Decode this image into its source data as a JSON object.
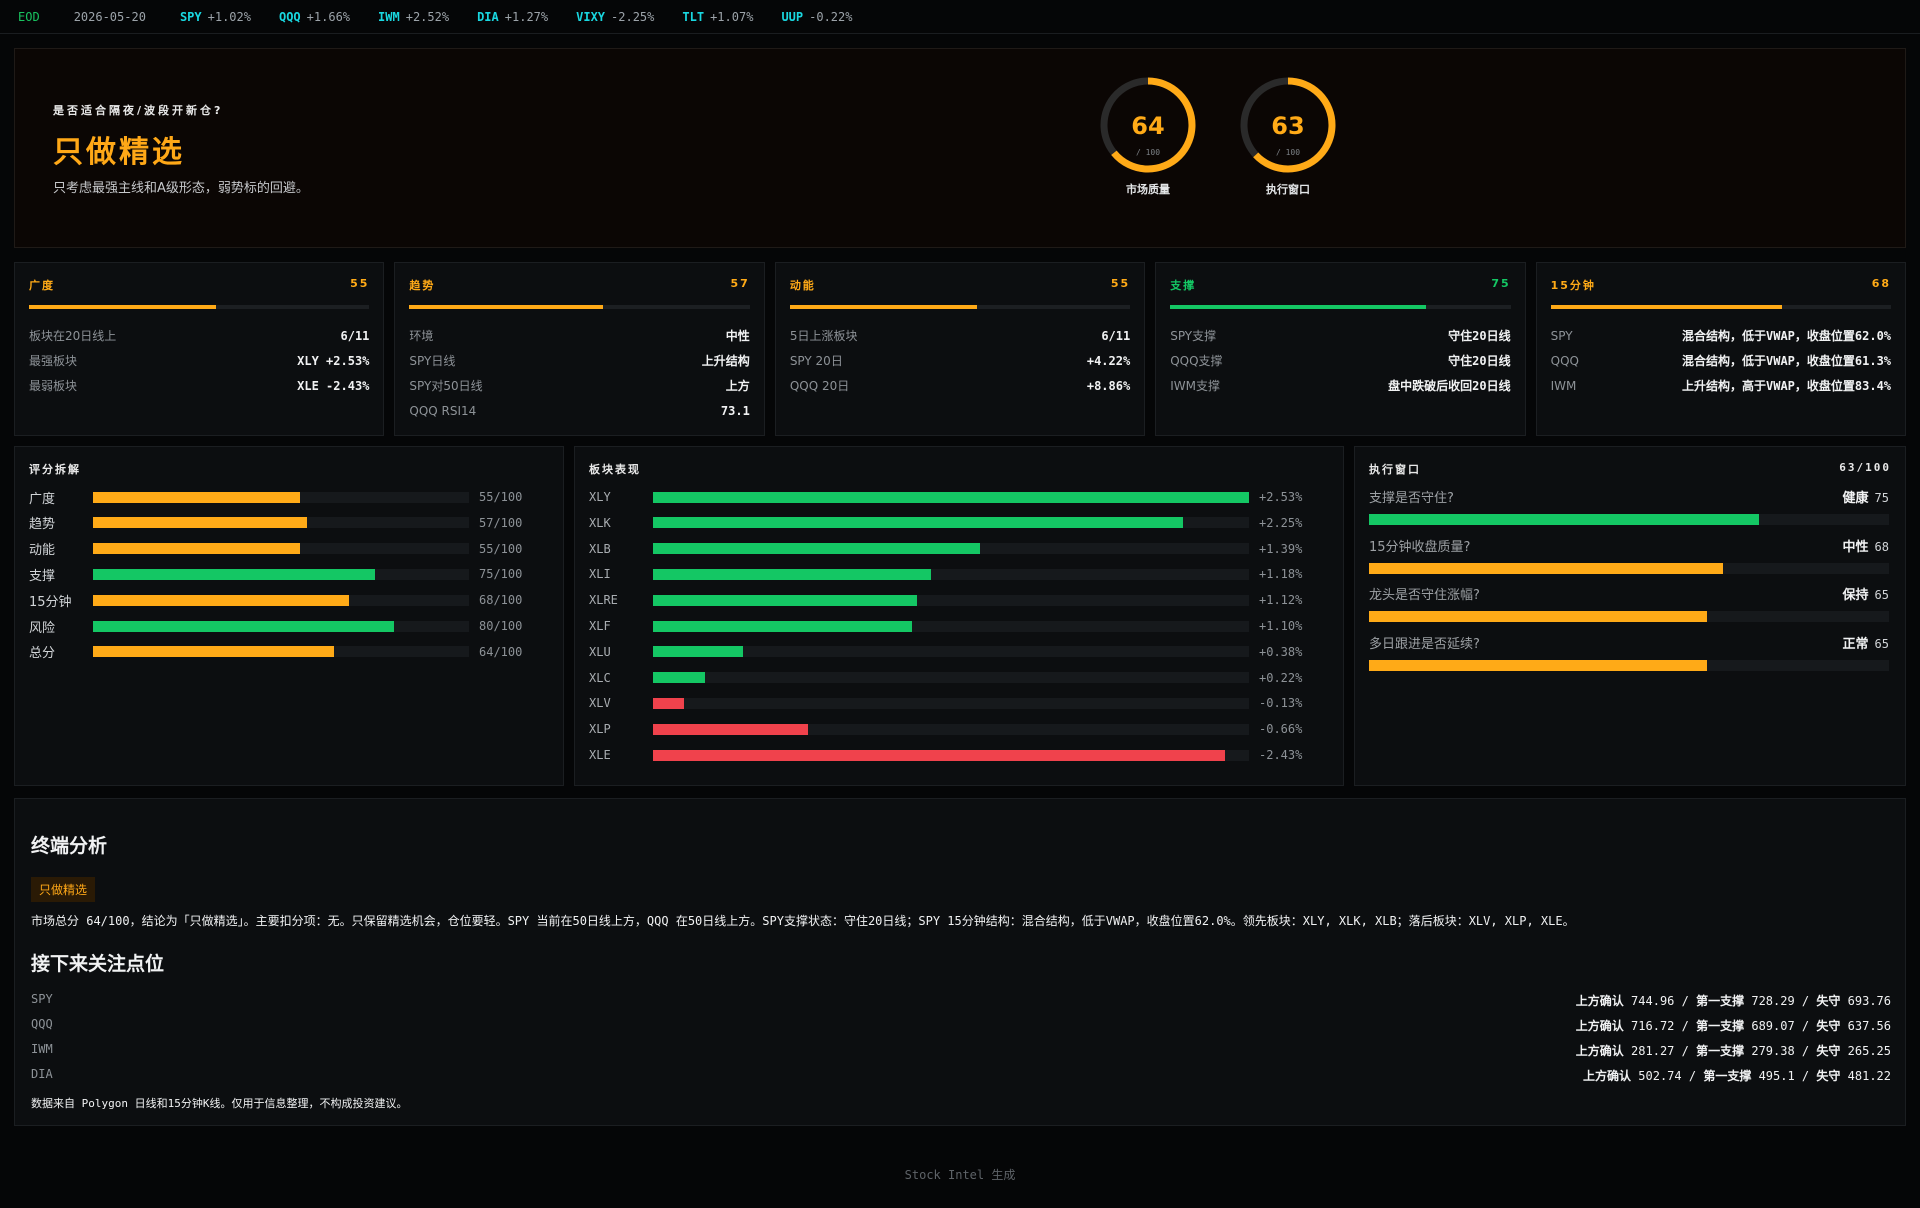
{
  "ticker": {
    "eod": "EOD",
    "date": "2026-05-20",
    "items": [
      {
        "sym": "SPY",
        "chg": "+1.02%"
      },
      {
        "sym": "QQQ",
        "chg": "+1.66%"
      },
      {
        "sym": "IWM",
        "chg": "+2.52%"
      },
      {
        "sym": "DIA",
        "chg": "+1.27%"
      },
      {
        "sym": "VIXY",
        "chg": "-2.25%"
      },
      {
        "sym": "TLT",
        "chg": "+1.07%"
      },
      {
        "sym": "UUP",
        "chg": "-0.22%"
      }
    ]
  },
  "hero": {
    "question": "是否适合隔夜/波段开新仓?",
    "verdict": "只做精选",
    "subtitle": "只考虑最强主线和A级形态，弱势标的回避。",
    "gauges": [
      {
        "value": 64,
        "value_text": "64",
        "denominator": "/ 100",
        "label": "市场质量"
      },
      {
        "value": 63,
        "value_text": "63",
        "denominator": "/ 100",
        "label": "执行窗口"
      }
    ]
  },
  "colors": {
    "orange": "#ffaa17",
    "green": "#14c764",
    "red": "#f0424c",
    "cyan": "#19d7e0"
  },
  "cards": [
    {
      "title": "广度",
      "score": "55",
      "level": 0.55,
      "color": "#ffaa17",
      "rows": [
        {
          "k": "板块在20日线上",
          "v": "6/11"
        },
        {
          "k": "最强板块",
          "v": "XLY +2.53%"
        },
        {
          "k": "最弱板块",
          "v": "XLE -2.43%"
        }
      ]
    },
    {
      "title": "趋势",
      "score": "57",
      "level": 0.57,
      "color": "#ffaa17",
      "rows": [
        {
          "k": "环境",
          "v": "中性"
        },
        {
          "k": "SPY日线",
          "v": "上升结构"
        },
        {
          "k": "SPY对50日线",
          "v": "上方"
        },
        {
          "k": "QQQ RSI14",
          "v": "73.1"
        }
      ]
    },
    {
      "title": "动能",
      "score": "55",
      "level": 0.55,
      "color": "#ffaa17",
      "rows": [
        {
          "k": "5日上涨板块",
          "v": "6/11"
        },
        {
          "k": "SPY 20日",
          "v": "+4.22%"
        },
        {
          "k": "QQQ 20日",
          "v": "+8.86%"
        }
      ]
    },
    {
      "title": "支撑",
      "score": "75",
      "level": 0.75,
      "color": "#14c764",
      "rows": [
        {
          "k": "SPY支撑",
          "v": "守住20日线"
        },
        {
          "k": "QQQ支撑",
          "v": "守住20日线"
        },
        {
          "k": "IWM支撑",
          "v": "盘中跌破后收回20日线"
        }
      ]
    },
    {
      "title": "15分钟",
      "score": "68",
      "level": 0.68,
      "color": "#ffaa17",
      "rows": [
        {
          "k": "SPY",
          "v": "混合结构，低于VWAP，收盘位置62.0%"
        },
        {
          "k": "QQQ",
          "v": "混合结构，低于VWAP，收盘位置61.3%"
        },
        {
          "k": "IWM",
          "v": "上升结构，高于VWAP，收盘位置83.4%"
        }
      ]
    }
  ],
  "scores": {
    "title": "评分拆解",
    "items": [
      {
        "label": "广度",
        "value": 55,
        "text": "55/100",
        "color": "#ffaa17"
      },
      {
        "label": "趋势",
        "value": 57,
        "text": "57/100",
        "color": "#ffaa17"
      },
      {
        "label": "动能",
        "value": 55,
        "text": "55/100",
        "color": "#ffaa17"
      },
      {
        "label": "支撑",
        "value": 75,
        "text": "75/100",
        "color": "#14c764"
      },
      {
        "label": "15分钟",
        "value": 68,
        "text": "68/100",
        "color": "#ffaa17"
      },
      {
        "label": "风险",
        "value": 80,
        "text": "80/100",
        "color": "#14c764"
      },
      {
        "label": "总分",
        "value": 64,
        "text": "64/100",
        "color": "#ffaa17"
      }
    ]
  },
  "sectors": {
    "title": "板块表现",
    "items": [
      {
        "sym": "XLY",
        "value": 2.53,
        "text": "+2.53%"
      },
      {
        "sym": "XLK",
        "value": 2.25,
        "text": "+2.25%"
      },
      {
        "sym": "XLB",
        "value": 1.39,
        "text": "+1.39%"
      },
      {
        "sym": "XLI",
        "value": 1.18,
        "text": "+1.18%"
      },
      {
        "sym": "XLRE",
        "value": 1.12,
        "text": "+1.12%"
      },
      {
        "sym": "XLF",
        "value": 1.1,
        "text": "+1.10%"
      },
      {
        "sym": "XLU",
        "value": 0.38,
        "text": "+0.38%"
      },
      {
        "sym": "XLC",
        "value": 0.22,
        "text": "+0.22%"
      },
      {
        "sym": "XLV",
        "value": -0.13,
        "text": "-0.13%"
      },
      {
        "sym": "XLP",
        "value": -0.66,
        "text": "-0.66%"
      },
      {
        "sym": "XLE",
        "value": -2.43,
        "text": "-2.43%"
      }
    ]
  },
  "execution": {
    "title": "执行窗口",
    "score": "63/100",
    "items": [
      {
        "q": "支撑是否守住?",
        "status": "健康",
        "score": "75",
        "value": 75,
        "color": "#14c764"
      },
      {
        "q": "15分钟收盘质量?",
        "status": "中性",
        "score": "68",
        "value": 68,
        "color": "#ffaa17"
      },
      {
        "q": "龙头是否守住涨幅?",
        "status": "保持",
        "score": "65",
        "value": 65,
        "color": "#ffaa17"
      },
      {
        "q": "多日跟进是否延续?",
        "status": "正常",
        "score": "65",
        "value": 65,
        "color": "#ffaa17"
      }
    ]
  },
  "analysis": {
    "heading": "终端分析",
    "badge": "只做精选",
    "paragraph": "市场总分 64/100，结论为「只做精选」。主要扣分项：无。只保留精选机会，仓位要轻。SPY 当前在50日线上方，QQQ 在50日线上方。SPY支撑状态：守住20日线；SPY 15分钟结构：混合结构，低于VWAP，收盘位置62.0%。领先板块：XLY, XLK, XLB；落后板块：XLV, XLP, XLE。",
    "levels_heading": "接下来关注点位",
    "labels": {
      "up": "上方确认",
      "sup": "第一支撑",
      "loss": "失守"
    },
    "levels": [
      {
        "sym": "SPY",
        "up": "744.96",
        "sup": "728.29",
        "loss": "693.76"
      },
      {
        "sym": "QQQ",
        "up": "716.72",
        "sup": "689.07",
        "loss": "637.56"
      },
      {
        "sym": "IWM",
        "up": "281.27",
        "sup": "279.38",
        "loss": "265.25"
      },
      {
        "sym": "DIA",
        "up": "502.74",
        "sup": "495.1",
        "loss": "481.22"
      }
    ],
    "footnote": "数据来自 Polygon 日线和15分钟K线。仅用于信息整理，不构成投资建议。"
  },
  "footer": "Stock Intel 生成"
}
